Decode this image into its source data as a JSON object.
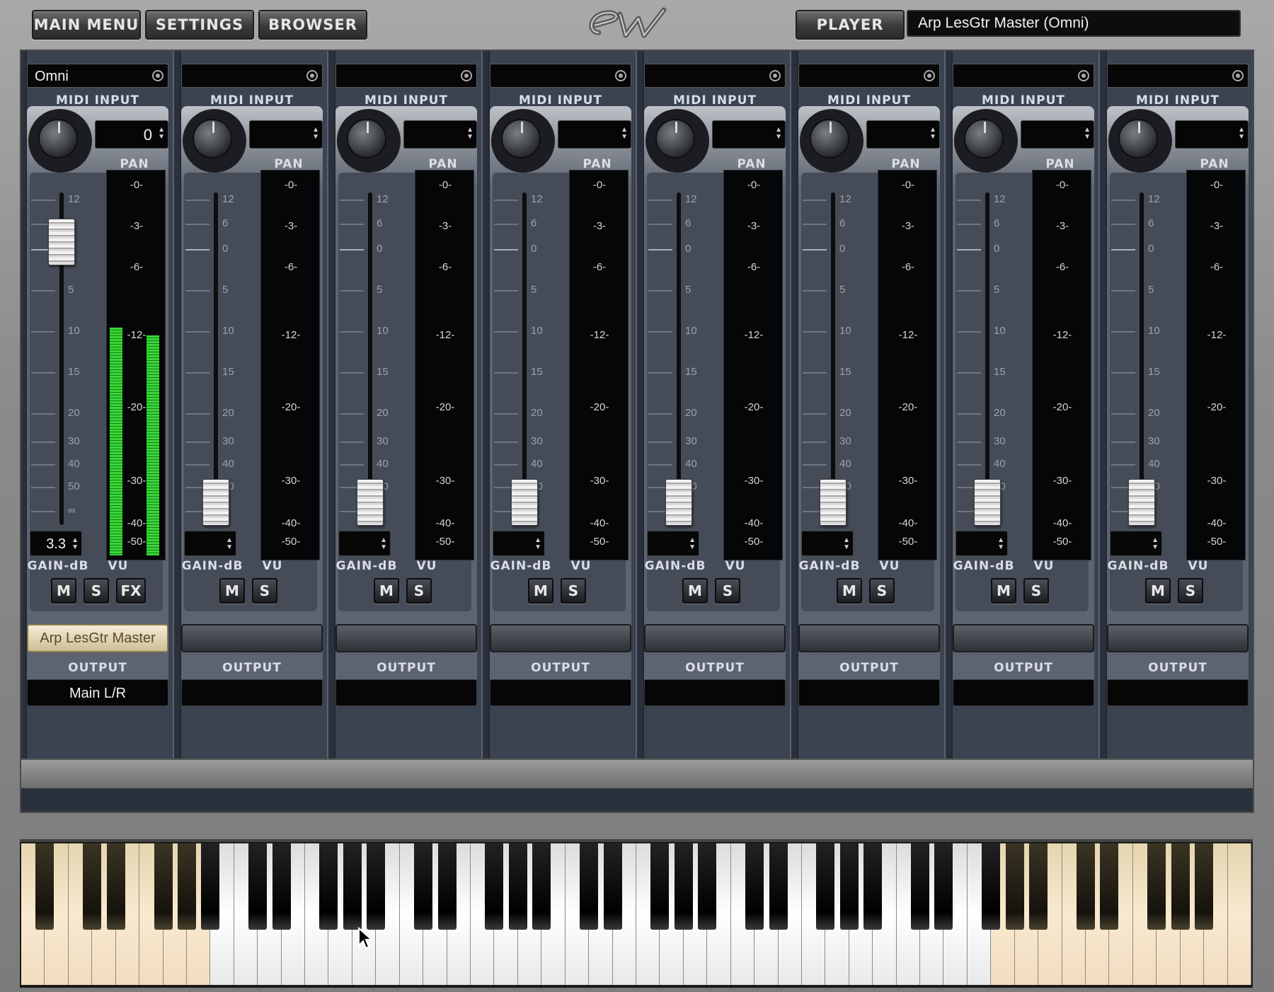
{
  "topbar": {
    "main_menu": "MAIN MENU",
    "settings": "SETTINGS",
    "browser": "BROWSER",
    "player": "PLAYER",
    "instrument_name": "Arp LesGtr Master (Omni)"
  },
  "labels": {
    "midi_input": "MIDI INPUT",
    "pan": "PAN",
    "gain_db": "GAIN-dB",
    "vu": "VU",
    "mute": "M",
    "solo": "S",
    "fx": "FX",
    "output": "OUTPUT"
  },
  "fader_scale": [
    "12",
    "6",
    "0",
    "5",
    "10",
    "15",
    "20",
    "30",
    "40",
    "50",
    "∞"
  ],
  "meter_scale": [
    "0",
    "3",
    "6",
    "12",
    "20",
    "30",
    "40",
    "50"
  ],
  "strips": [
    {
      "midi": "Omni",
      "pan": "0",
      "gain": "3.3",
      "fader_level": 0.85,
      "vu_left": 0.6,
      "vu_right": 0.58,
      "instrument": "Arp LesGtr Master",
      "output": "Main L/R",
      "has_fx": true
    },
    {
      "midi": "",
      "pan": "",
      "gain": "",
      "fader_level": 0.05,
      "vu_left": 0,
      "vu_right": 0,
      "instrument": "",
      "output": "",
      "has_fx": false
    },
    {
      "midi": "",
      "pan": "",
      "gain": "",
      "fader_level": 0.05,
      "vu_left": 0,
      "vu_right": 0,
      "instrument": "",
      "output": "",
      "has_fx": false
    },
    {
      "midi": "",
      "pan": "",
      "gain": "",
      "fader_level": 0.05,
      "vu_left": 0,
      "vu_right": 0,
      "instrument": "",
      "output": "",
      "has_fx": false
    },
    {
      "midi": "",
      "pan": "",
      "gain": "",
      "fader_level": 0.05,
      "vu_left": 0,
      "vu_right": 0,
      "instrument": "",
      "output": "",
      "has_fx": false
    },
    {
      "midi": "",
      "pan": "",
      "gain": "",
      "fader_level": 0.05,
      "vu_left": 0,
      "vu_right": 0,
      "instrument": "",
      "output": "",
      "has_fx": false
    },
    {
      "midi": "",
      "pan": "",
      "gain": "",
      "fader_level": 0.05,
      "vu_left": 0,
      "vu_right": 0,
      "instrument": "",
      "output": "",
      "has_fx": false
    },
    {
      "midi": "",
      "pan": "",
      "gain": "",
      "fader_level": 0.05,
      "vu_left": 0,
      "vu_right": 0,
      "instrument": "",
      "output": "",
      "has_fx": false
    }
  ],
  "colors": {
    "vu_green": "#36d936",
    "active_slot": "#f4ecd5",
    "keyboard_range": "#f8e9cf"
  },
  "icons": [
    "ew-logo-icon",
    "midi-channel-icon",
    "pan-knob-icon",
    "spinner-arrows-icon",
    "mouse-cursor-icon"
  ]
}
